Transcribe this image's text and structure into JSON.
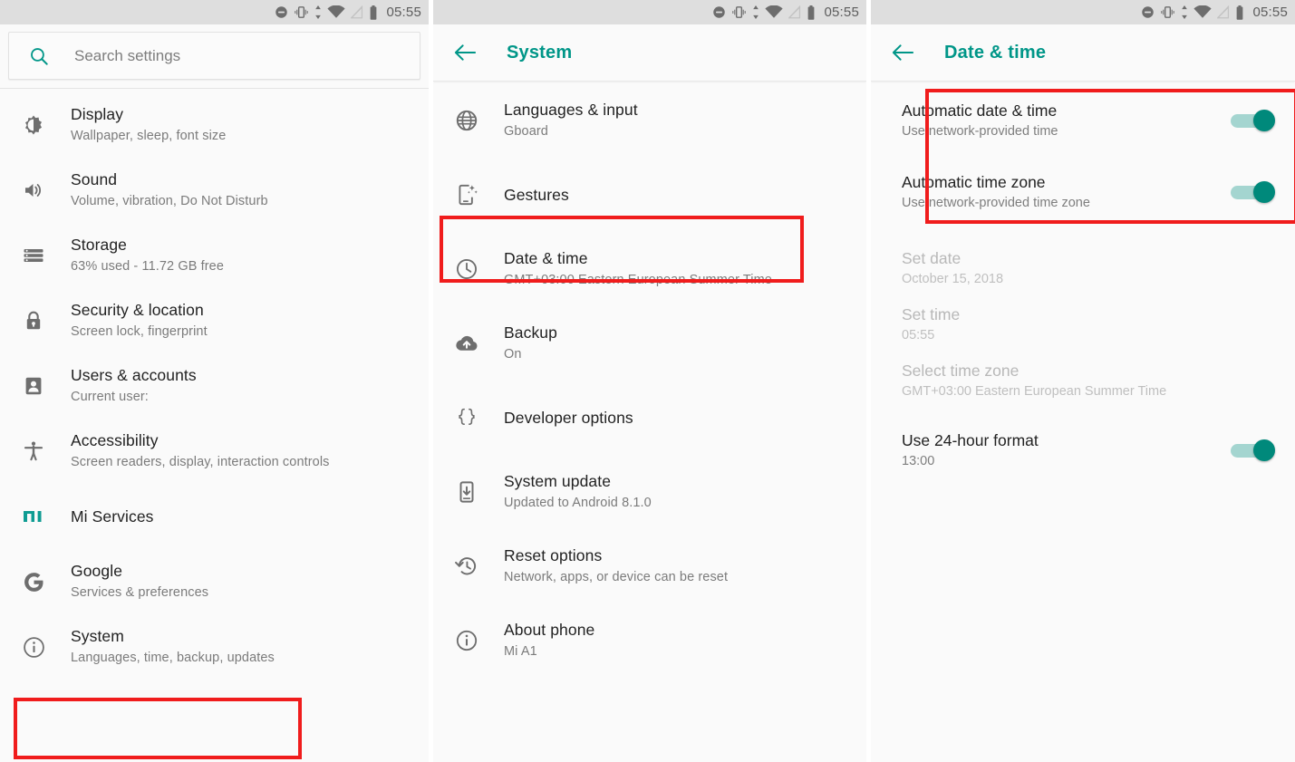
{
  "colors": {
    "accent": "#009688",
    "annotation": "#f01c1c",
    "toggle_on": "#00897b",
    "toggle_track": "#a4d5d0"
  },
  "status_bar": {
    "time": "05:55",
    "icons": [
      "do-not-disturb-icon",
      "vibrate-icon",
      "data-transfer-icon",
      "wifi-icon",
      "signal-off-icon",
      "battery-icon"
    ]
  },
  "panel_settings": {
    "search": {
      "placeholder": "Search settings"
    },
    "items": [
      {
        "icon": "brightness-icon",
        "title": "Display",
        "subtitle": "Wallpaper, sleep, font size"
      },
      {
        "icon": "volume-icon",
        "title": "Sound",
        "subtitle": "Volume, vibration, Do Not Disturb"
      },
      {
        "icon": "storage-icon",
        "title": "Storage",
        "subtitle": "63% used - 11.72 GB free"
      },
      {
        "icon": "lock-icon",
        "title": "Security & location",
        "subtitle": "Screen lock, fingerprint"
      },
      {
        "icon": "account-icon",
        "title": "Users & accounts",
        "subtitle": "Current user:"
      },
      {
        "icon": "accessibility-icon",
        "title": "Accessibility",
        "subtitle": "Screen readers, display, interaction controls"
      },
      {
        "icon": "mi-logo-icon",
        "title": "Mi Services",
        "subtitle": ""
      },
      {
        "icon": "google-g-icon",
        "title": "Google",
        "subtitle": "Services & preferences"
      },
      {
        "icon": "info-icon",
        "title": "System",
        "subtitle": "Languages, time, backup, updates"
      }
    ]
  },
  "panel_system": {
    "appbar": {
      "title": "System",
      "back_icon": "back-arrow-icon"
    },
    "items": [
      {
        "icon": "globe-icon",
        "title": "Languages & input",
        "subtitle": "Gboard"
      },
      {
        "icon": "gestures-icon",
        "title": "Gestures",
        "subtitle": ""
      },
      {
        "icon": "clock-icon",
        "title": "Date & time",
        "subtitle": "GMT+03:00 Eastern European Summer Time"
      },
      {
        "icon": "cloud-upload-icon",
        "title": "Backup",
        "subtitle": "On"
      },
      {
        "icon": "braces-icon",
        "title": "Developer options",
        "subtitle": ""
      },
      {
        "icon": "system-update-icon",
        "title": "System update",
        "subtitle": "Updated to Android 8.1.0"
      },
      {
        "icon": "restore-icon",
        "title": "Reset options",
        "subtitle": "Network, apps, or device can be reset"
      },
      {
        "icon": "info-icon",
        "title": "About phone",
        "subtitle": "Mi A1"
      }
    ]
  },
  "panel_datetime": {
    "appbar": {
      "title": "Date & time",
      "back_icon": "back-arrow-icon"
    },
    "items": [
      {
        "title": "Automatic date & time",
        "subtitle": "Use network-provided time",
        "toggle": true,
        "enabled": true
      },
      {
        "title": "Automatic time zone",
        "subtitle": "Use network-provided time zone",
        "toggle": true,
        "enabled": true
      },
      {
        "title": "Set date",
        "subtitle": "October 15, 2018",
        "toggle": false,
        "enabled": false
      },
      {
        "title": "Set time",
        "subtitle": "05:55",
        "toggle": false,
        "enabled": false
      },
      {
        "title": "Select time zone",
        "subtitle": "GMT+03:00 Eastern European Summer Time",
        "toggle": false,
        "enabled": false
      },
      {
        "title": "Use 24-hour format",
        "subtitle": "13:00",
        "toggle": true,
        "enabled": true
      }
    ]
  }
}
